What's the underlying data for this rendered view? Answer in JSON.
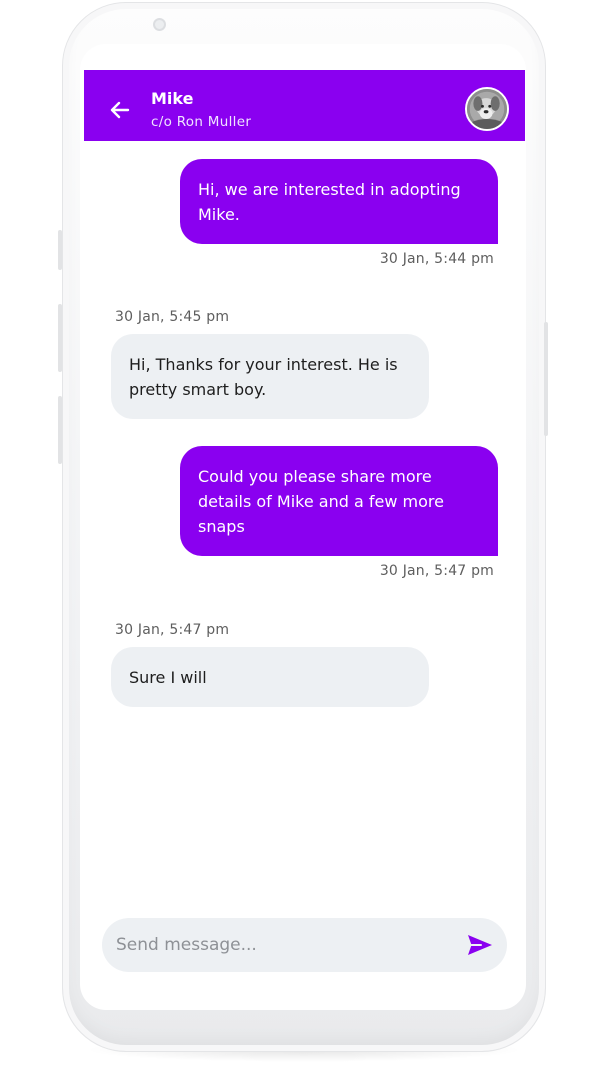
{
  "header": {
    "name": "Mike",
    "subtitle": "c/o Ron Muller"
  },
  "messages": [
    {
      "direction": "sent",
      "text": "Hi, we are interested in adopting Mike.",
      "time": "30 Jan, 5:44 pm"
    },
    {
      "direction": "received",
      "text": "Hi, Thanks for your interest. He is pretty smart boy.",
      "time": "30 Jan, 5:45 pm"
    },
    {
      "direction": "sent",
      "text": "Could you please share more details of Mike and a few more snaps",
      "time": "30 Jan, 5:47 pm"
    },
    {
      "direction": "received",
      "text": "Sure I will",
      "time": "30 Jan, 5:47 pm"
    }
  ],
  "composer": {
    "placeholder": "Send message..."
  },
  "colors": {
    "accent": "#8a00f0",
    "received_bubble": "#edf0f3",
    "input_bg": "#edf0f3"
  },
  "icons": {
    "back": "arrow-left-icon",
    "send": "send-icon",
    "avatar": "dog-photo-avatar"
  }
}
